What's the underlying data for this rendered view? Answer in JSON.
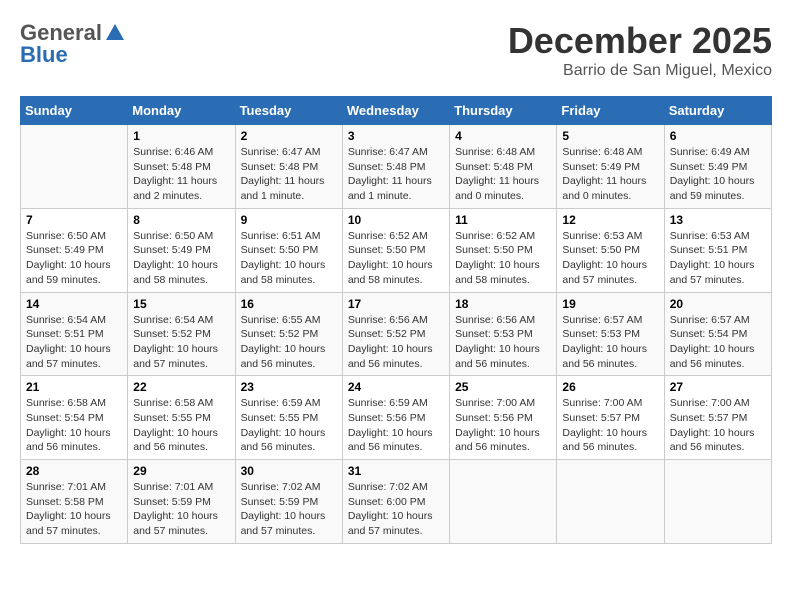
{
  "logo": {
    "general": "General",
    "blue": "Blue"
  },
  "title": "December 2025",
  "location": "Barrio de San Miguel, Mexico",
  "days_of_week": [
    "Sunday",
    "Monday",
    "Tuesday",
    "Wednesday",
    "Thursday",
    "Friday",
    "Saturday"
  ],
  "weeks": [
    [
      {
        "day": "",
        "info": ""
      },
      {
        "day": "1",
        "info": "Sunrise: 6:46 AM\nSunset: 5:48 PM\nDaylight: 11 hours and 2 minutes."
      },
      {
        "day": "2",
        "info": "Sunrise: 6:47 AM\nSunset: 5:48 PM\nDaylight: 11 hours and 1 minute."
      },
      {
        "day": "3",
        "info": "Sunrise: 6:47 AM\nSunset: 5:48 PM\nDaylight: 11 hours and 1 minute."
      },
      {
        "day": "4",
        "info": "Sunrise: 6:48 AM\nSunset: 5:48 PM\nDaylight: 11 hours and 0 minutes."
      },
      {
        "day": "5",
        "info": "Sunrise: 6:48 AM\nSunset: 5:49 PM\nDaylight: 11 hours and 0 minutes."
      },
      {
        "day": "6",
        "info": "Sunrise: 6:49 AM\nSunset: 5:49 PM\nDaylight: 10 hours and 59 minutes."
      }
    ],
    [
      {
        "day": "7",
        "info": "Sunrise: 6:50 AM\nSunset: 5:49 PM\nDaylight: 10 hours and 59 minutes."
      },
      {
        "day": "8",
        "info": "Sunrise: 6:50 AM\nSunset: 5:49 PM\nDaylight: 10 hours and 58 minutes."
      },
      {
        "day": "9",
        "info": "Sunrise: 6:51 AM\nSunset: 5:50 PM\nDaylight: 10 hours and 58 minutes."
      },
      {
        "day": "10",
        "info": "Sunrise: 6:52 AM\nSunset: 5:50 PM\nDaylight: 10 hours and 58 minutes."
      },
      {
        "day": "11",
        "info": "Sunrise: 6:52 AM\nSunset: 5:50 PM\nDaylight: 10 hours and 58 minutes."
      },
      {
        "day": "12",
        "info": "Sunrise: 6:53 AM\nSunset: 5:50 PM\nDaylight: 10 hours and 57 minutes."
      },
      {
        "day": "13",
        "info": "Sunrise: 6:53 AM\nSunset: 5:51 PM\nDaylight: 10 hours and 57 minutes."
      }
    ],
    [
      {
        "day": "14",
        "info": "Sunrise: 6:54 AM\nSunset: 5:51 PM\nDaylight: 10 hours and 57 minutes."
      },
      {
        "day": "15",
        "info": "Sunrise: 6:54 AM\nSunset: 5:52 PM\nDaylight: 10 hours and 57 minutes."
      },
      {
        "day": "16",
        "info": "Sunrise: 6:55 AM\nSunset: 5:52 PM\nDaylight: 10 hours and 56 minutes."
      },
      {
        "day": "17",
        "info": "Sunrise: 6:56 AM\nSunset: 5:52 PM\nDaylight: 10 hours and 56 minutes."
      },
      {
        "day": "18",
        "info": "Sunrise: 6:56 AM\nSunset: 5:53 PM\nDaylight: 10 hours and 56 minutes."
      },
      {
        "day": "19",
        "info": "Sunrise: 6:57 AM\nSunset: 5:53 PM\nDaylight: 10 hours and 56 minutes."
      },
      {
        "day": "20",
        "info": "Sunrise: 6:57 AM\nSunset: 5:54 PM\nDaylight: 10 hours and 56 minutes."
      }
    ],
    [
      {
        "day": "21",
        "info": "Sunrise: 6:58 AM\nSunset: 5:54 PM\nDaylight: 10 hours and 56 minutes."
      },
      {
        "day": "22",
        "info": "Sunrise: 6:58 AM\nSunset: 5:55 PM\nDaylight: 10 hours and 56 minutes."
      },
      {
        "day": "23",
        "info": "Sunrise: 6:59 AM\nSunset: 5:55 PM\nDaylight: 10 hours and 56 minutes."
      },
      {
        "day": "24",
        "info": "Sunrise: 6:59 AM\nSunset: 5:56 PM\nDaylight: 10 hours and 56 minutes."
      },
      {
        "day": "25",
        "info": "Sunrise: 7:00 AM\nSunset: 5:56 PM\nDaylight: 10 hours and 56 minutes."
      },
      {
        "day": "26",
        "info": "Sunrise: 7:00 AM\nSunset: 5:57 PM\nDaylight: 10 hours and 56 minutes."
      },
      {
        "day": "27",
        "info": "Sunrise: 7:00 AM\nSunset: 5:57 PM\nDaylight: 10 hours and 56 minutes."
      }
    ],
    [
      {
        "day": "28",
        "info": "Sunrise: 7:01 AM\nSunset: 5:58 PM\nDaylight: 10 hours and 57 minutes."
      },
      {
        "day": "29",
        "info": "Sunrise: 7:01 AM\nSunset: 5:59 PM\nDaylight: 10 hours and 57 minutes."
      },
      {
        "day": "30",
        "info": "Sunrise: 7:02 AM\nSunset: 5:59 PM\nDaylight: 10 hours and 57 minutes."
      },
      {
        "day": "31",
        "info": "Sunrise: 7:02 AM\nSunset: 6:00 PM\nDaylight: 10 hours and 57 minutes."
      },
      {
        "day": "",
        "info": ""
      },
      {
        "day": "",
        "info": ""
      },
      {
        "day": "",
        "info": ""
      }
    ]
  ]
}
